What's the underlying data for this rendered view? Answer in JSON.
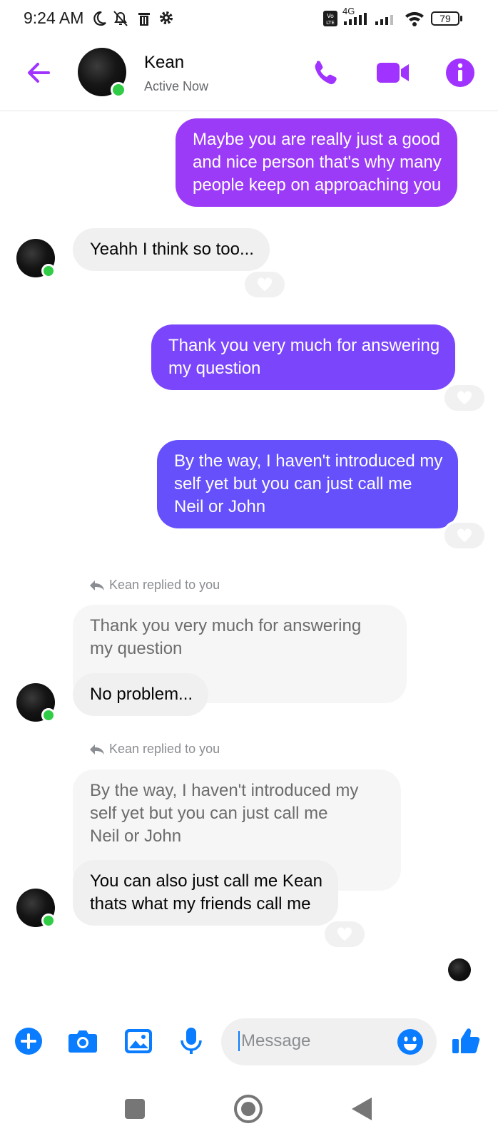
{
  "status_bar": {
    "time": "9:24 AM",
    "network": "4G",
    "battery": "79",
    "icons": [
      "moon-icon",
      "bell-off-icon",
      "trash-icon",
      "gear-icon",
      "volte-icon",
      "signal-icon",
      "wifi-icon",
      "battery-icon"
    ]
  },
  "header": {
    "contact_name": "Kean",
    "status": "Active Now",
    "icons": [
      "back-arrow-icon",
      "phone-icon",
      "video-icon",
      "info-icon"
    ]
  },
  "colors": {
    "accent": "#a033ff",
    "bubble_1": "#9b3bf7",
    "bubble_2": "#7b46fb",
    "bubble_3": "#6550fc",
    "online": "#31cc46",
    "composer_blue": "#0a7cff"
  },
  "messages": [
    {
      "sender": "me",
      "lines": [
        "Maybe you are really just a good",
        "and nice person that's why many",
        "people keep on approaching you"
      ]
    },
    {
      "sender": "Kean",
      "lines": [
        "Yeahh I think so too..."
      ],
      "reaction": "heart"
    },
    {
      "sender": "me",
      "lines": [
        "Thank you very much for answering",
        "my question"
      ],
      "reaction": "heart"
    },
    {
      "sender": "me",
      "lines": [
        "By the way, I haven't introduced my",
        "self yet but you can just call me",
        "Neil or John"
      ],
      "reaction": "heart"
    },
    {
      "sender": "Kean",
      "reply_label": "Kean replied to you",
      "quoted_lines": [
        "Thank you very much for answering",
        "my question"
      ],
      "lines": [
        "No problem..."
      ]
    },
    {
      "sender": "Kean",
      "reply_label": "Kean replied to you",
      "quoted_lines": [
        "By the way, I haven't introduced my",
        "self yet but you can just call me",
        "Neil or John"
      ],
      "lines": [
        "You can also just call me Kean",
        "thats what my friends call me"
      ],
      "reaction": "heart"
    }
  ],
  "composer": {
    "placeholder": "Message",
    "icons": [
      "plus-icon",
      "camera-icon",
      "image-icon",
      "microphone-icon",
      "emoji-icon",
      "thumbs-up-icon"
    ]
  },
  "nav_bar": {
    "icons": [
      "recents-square-icon",
      "home-circle-icon",
      "back-triangle-icon"
    ]
  }
}
